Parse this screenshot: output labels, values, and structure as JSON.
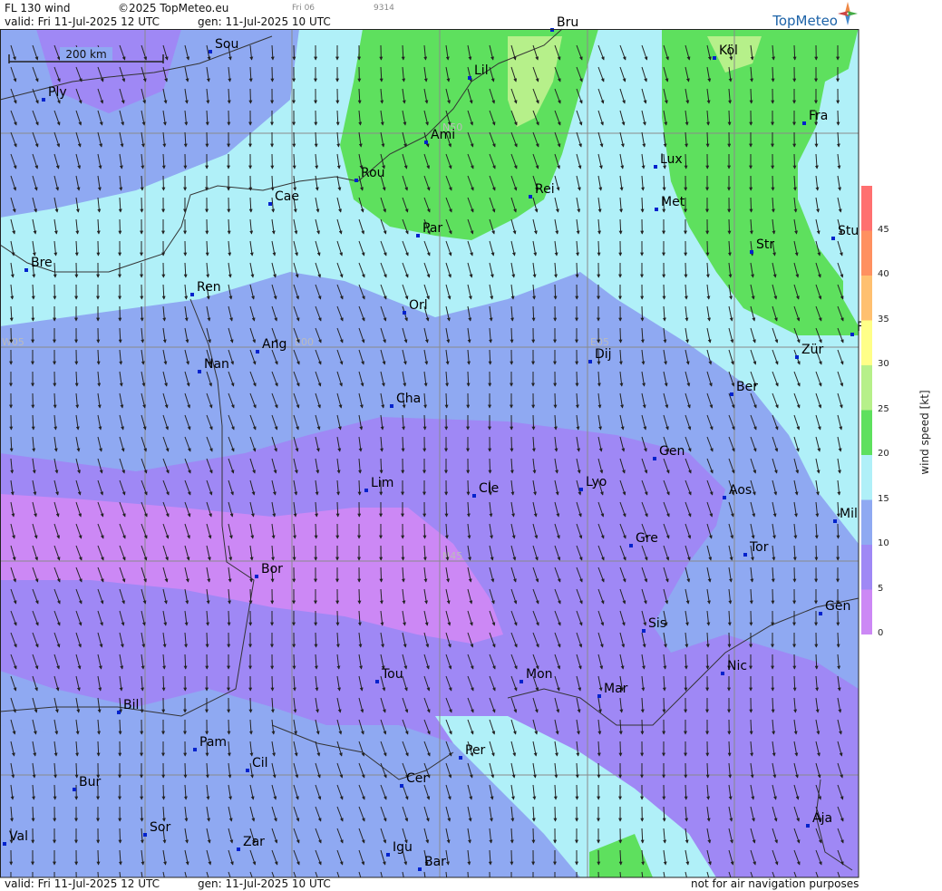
{
  "header": {
    "product": "FL 130 wind",
    "copyright": "©2025 TopMeteo.eu",
    "day_tag": "Fri 06",
    "code": "9314",
    "valid": "valid:  Fri  11-Jul-2025  12 UTC",
    "gen": "gen: 11-Jul-2025 10 UTC",
    "logo": "TopMeteo"
  },
  "footer": {
    "valid": "valid:  Fri  11-Jul-2025  12 UTC",
    "gen": "gen: 11-Jul-2025 10 UTC",
    "disclaimer": "not for air navigation purposes"
  },
  "scale_bar": {
    "label": "200 km"
  },
  "legend": {
    "title": "wind  speed  [kt]",
    "ticks": [
      "0",
      "5",
      "10",
      "15",
      "20",
      "25",
      "30",
      "35",
      "40",
      "45"
    ],
    "colors": [
      "#cc88f5",
      "#9f88f5",
      "#8fa9f2",
      "#b0f0f8",
      "#5ee05e",
      "#b6f08a",
      "#ffff88",
      "#ffc070",
      "#ff9060",
      "#ff7070"
    ]
  },
  "grid_labels": [
    "N50",
    "N45",
    "W05",
    "E00",
    "E05"
  ],
  "cities": [
    "Sou",
    "Ply",
    "Lil",
    "Bru",
    "Köl",
    "Ami",
    "Fra",
    "Rou",
    "Lux",
    "Rei",
    "Cae",
    "Met",
    "Par",
    "Stu",
    "Bre",
    "Str",
    "Ren",
    "Orl",
    "F",
    "Ang",
    "Dij",
    "Zür",
    "Nan",
    "Ber",
    "Cha",
    "Gen",
    "Lim",
    "Cle",
    "Lyo",
    "Aos",
    "Mil",
    "Gre",
    "Tor",
    "Bor",
    "Gen",
    "Sis",
    "Nic",
    "Tou",
    "Mon",
    "Mar",
    "Bil",
    "Pam",
    "Cil",
    "Per",
    "Cer",
    "Bur",
    "Sor",
    "Aja",
    "Val",
    "Zar",
    "Igu",
    "Bar"
  ],
  "wind_direction": "north-northeast, flowing southward"
}
